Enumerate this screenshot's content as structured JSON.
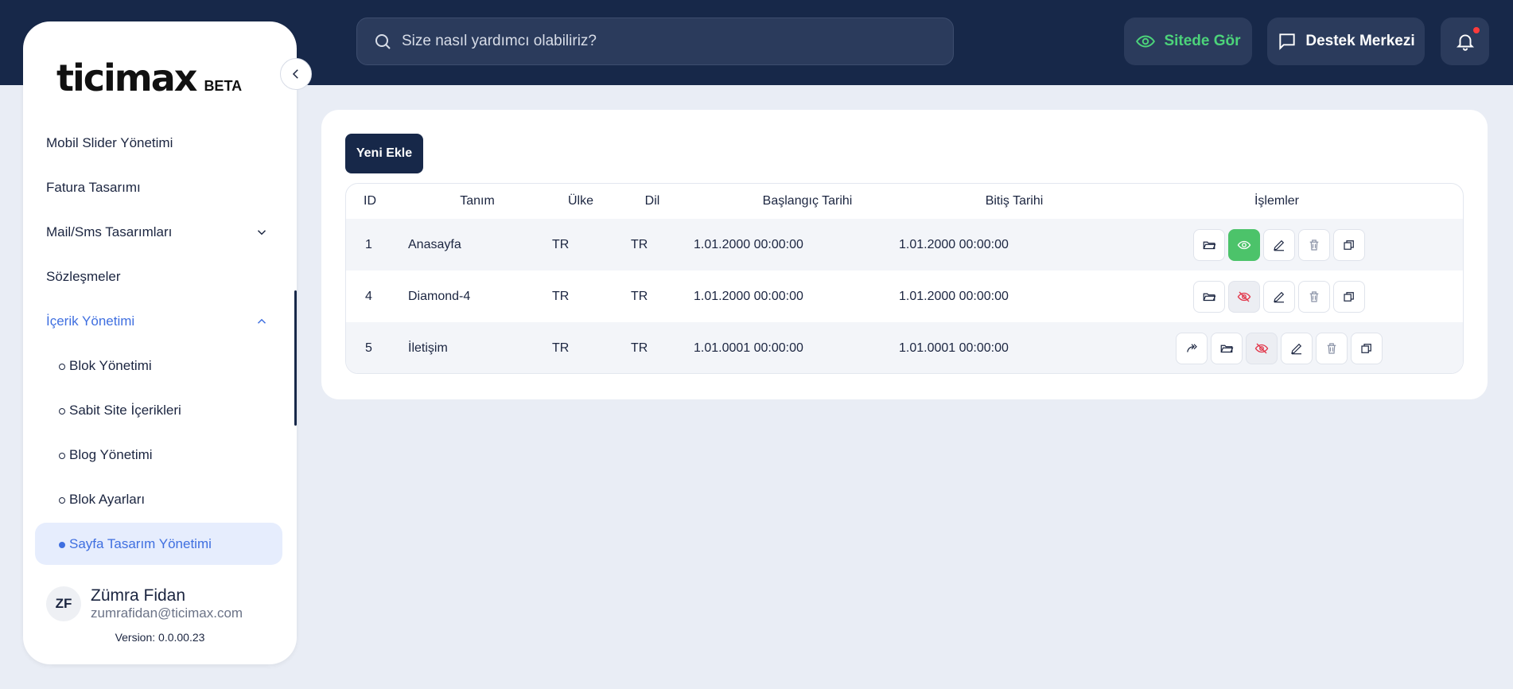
{
  "search": {
    "placeholder": "Size nasıl yardımcı olabiliriz?"
  },
  "header": {
    "site_btn": "Sitede Gör",
    "support_btn": "Destek Merkezi",
    "notification_dot_color": "#ff3b3b"
  },
  "sidebar": {
    "logo": "ticimax",
    "beta": "BETA",
    "items": [
      {
        "label": "Mobil Slider Yönetimi"
      },
      {
        "label": "Fatura Tasarımı"
      },
      {
        "label": "Mail/Sms Tasarımları",
        "icon": "chevron-down-icon"
      },
      {
        "label": "Sözleşmeler"
      },
      {
        "label": "İçerik Yönetimi",
        "icon": "chevron-up-icon",
        "active": true
      }
    ],
    "subitems": [
      {
        "label": "Blok Yönetimi"
      },
      {
        "label": "Sabit Site İçerikleri"
      },
      {
        "label": "Blog Yönetimi"
      },
      {
        "label": "Blok Ayarları"
      },
      {
        "label": "Sayfa Tasarım Yönetimi",
        "active": true
      }
    ],
    "user": {
      "initials": "ZF",
      "name": "Zümra Fidan",
      "email": "zumrafidan@ticimax.com"
    },
    "version": "Version: 0.0.00.23"
  },
  "main": {
    "new_button": "Yeni Ekle",
    "table": {
      "headers": [
        "ID",
        "Tanım",
        "Ülke",
        "Dil",
        "Başlangıç Tarihi",
        "Bitiş Tarihi",
        "İşlemler"
      ],
      "rows": [
        {
          "id": "1",
          "name": "Anasayfa",
          "country": "TR",
          "lang": "TR",
          "start": "1.01.2000 00:00:00",
          "end": "1.01.2000 00:00:00",
          "visible": true,
          "redirect": false
        },
        {
          "id": "4",
          "name": "Diamond-4",
          "country": "TR",
          "lang": "TR",
          "start": "1.01.2000 00:00:00",
          "end": "1.01.2000 00:00:00",
          "visible": false,
          "redirect": false
        },
        {
          "id": "5",
          "name": "İletişim",
          "country": "TR",
          "lang": "TR",
          "start": "1.01.0001 00:00:00",
          "end": "1.01.0001 00:00:00",
          "visible": false,
          "redirect": true
        }
      ]
    }
  },
  "colors": {
    "navy": "#172849",
    "accent_blue": "#3f6fe0",
    "green": "#4cc36a",
    "hidden_red": "#e2374b"
  }
}
